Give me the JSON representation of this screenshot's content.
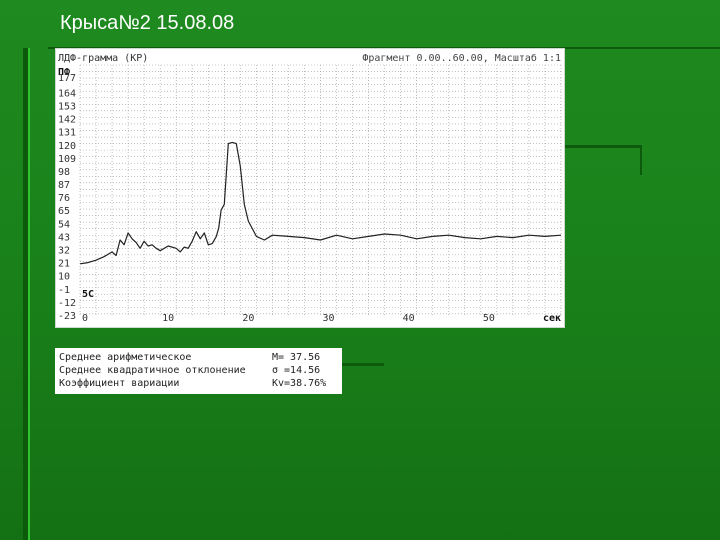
{
  "slide": {
    "title": "Крыса№2 15.08.08"
  },
  "colors": {
    "background": "#1a821a",
    "accent_dark": "#0d5a0d",
    "accent_light": "#2fc42f",
    "trace": "#222222",
    "grid": "#9a9a9a"
  },
  "chart_data": {
    "type": "line",
    "title": "ЛДФ-грамма (КР)",
    "subtitle": "Фрагмент 0.00..60.00, Масштаб 1:1",
    "ylabel": "ПФ",
    "xlabel": "сек",
    "y_tick_labels": [
      "177",
      "164",
      "153",
      "142",
      "131",
      "120",
      "109",
      "98",
      "87",
      "76",
      "65",
      "54",
      "43",
      "32",
      "21",
      "10",
      "-1",
      "-12",
      "-23"
    ],
    "x_tick_labels": [
      "0",
      "10",
      "20",
      "30",
      "40",
      "50"
    ],
    "xlim": [
      0,
      60
    ],
    "ylim": [
      -23,
      187
    ],
    "grid": true,
    "annotations": [
      "5С"
    ],
    "series": [
      {
        "x": [
          0.0,
          1.0,
          2.0,
          3.0,
          4.0,
          4.5,
          5.0,
          5.5,
          6.0,
          6.5,
          7.0,
          7.5,
          8.0,
          8.5,
          9.0,
          9.5,
          10.0,
          11.0,
          12.0,
          12.5,
          13.0,
          13.5,
          14.0,
          14.5,
          15.0,
          15.5,
          16.0,
          16.5,
          17.0,
          17.3,
          17.6,
          18.0,
          18.5,
          19.0,
          19.5,
          20.0,
          20.5,
          21.0,
          22.0,
          23.0,
          24.0,
          26.0,
          28.0,
          30.0,
          32.0,
          34.0,
          36.0,
          38.0,
          40.0,
          42.0,
          44.0,
          46.0,
          48.0,
          50.0,
          52.0,
          54.0,
          56.0,
          58.0,
          60.0
        ],
        "y": [
          20,
          21,
          23,
          26,
          30,
          27,
          40,
          36,
          46,
          41,
          38,
          33,
          39,
          35,
          36,
          33,
          31,
          35,
          33,
          30,
          34,
          33,
          39,
          47,
          41,
          46,
          36,
          37,
          43,
          50,
          65,
          70,
          121,
          122,
          121,
          102,
          70,
          56,
          43,
          40,
          44,
          43,
          42,
          40,
          44,
          41,
          43,
          45,
          44,
          41,
          43,
          44,
          42,
          41,
          43,
          42,
          44,
          43,
          44
        ]
      }
    ]
  },
  "stats": {
    "rows": [
      {
        "label": "Среднее арифметическое",
        "value": "M= 37.56"
      },
      {
        "label": "Среднее квадратичное отклонение",
        "value": "σ =14.56"
      },
      {
        "label": "Коэффициент вариации",
        "value": "Kv=38.76%"
      }
    ]
  }
}
